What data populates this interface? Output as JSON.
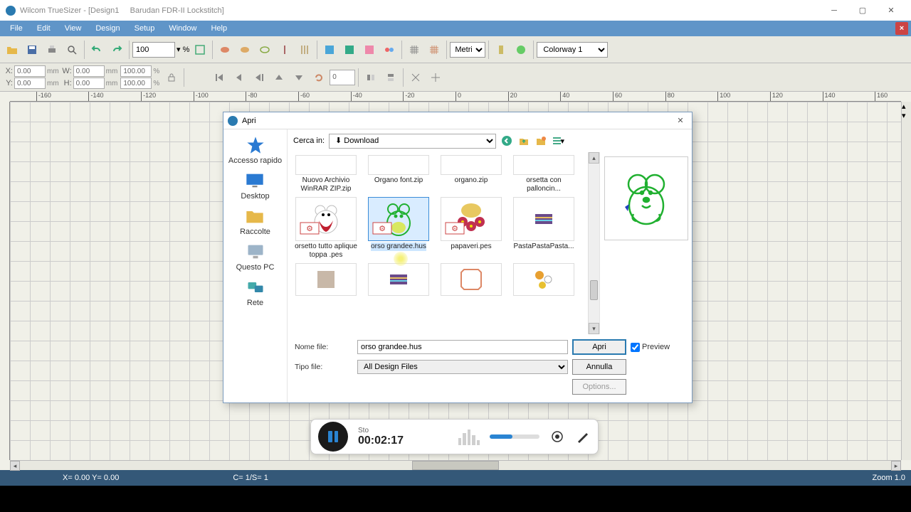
{
  "titlebar": {
    "app": "Wilcom TrueSizer - [Design1",
    "doc": "Barudan FDR-II Lockstitch]"
  },
  "menu": {
    "file": "File",
    "edit": "Edit",
    "view": "View",
    "design": "Design",
    "setup": "Setup",
    "window": "Window",
    "help": "Help"
  },
  "toolbar": {
    "zoom_value": "100",
    "zoom_pct": "%",
    "units": "Metric",
    "colorway": "Colorway 1"
  },
  "props": {
    "x_lbl": "X:",
    "x": "0.00",
    "y_lbl": "Y:",
    "y": "0.00",
    "mm": "mm",
    "w_lbl": "W:",
    "w": "0.00",
    "h_lbl": "H:",
    "h": "0.00",
    "wp": "100.00",
    "hp": "100.00",
    "pct": "%",
    "ang": "0"
  },
  "ruler_ticks": [
    "-160",
    "-140",
    "-120",
    "-100",
    "-80",
    "-60",
    "-40",
    "-20",
    "0",
    "20",
    "40",
    "60",
    "80",
    "100",
    "120",
    "140",
    "160"
  ],
  "dialog": {
    "title": "Apri",
    "lookin_label": "Cerca in:",
    "lookin_value": "Download",
    "places": {
      "quick": "Accesso rapido",
      "desktop": "Desktop",
      "collections": "Raccolte",
      "thispc": "Questo PC",
      "network": "Rete"
    },
    "files_row1": [
      {
        "name": "Nuovo Archivio WinRAR ZIP.zip"
      },
      {
        "name": "Organo font.zip"
      },
      {
        "name": "organo.zip"
      },
      {
        "name": "orsetta con palloncin..."
      }
    ],
    "files_row2": [
      {
        "name": "orsetto tutto aplique toppa .pes"
      },
      {
        "name": "orso grandee.hus",
        "selected": true
      },
      {
        "name": "papaveri.pes"
      },
      {
        "name": "PastaPastaPasta..."
      }
    ],
    "filename_label": "Nome file:",
    "filename_value": "orso grandee.hus",
    "filetype_label": "Tipo file:",
    "filetype_value": "All Design Files",
    "open_btn": "Apri",
    "cancel_btn": "Annulla",
    "options_btn": "Options...",
    "preview_label": "Preview"
  },
  "recorder": {
    "status": "Sto",
    "time": "00:02:17"
  },
  "status": {
    "xy": "X=   0.00 Y=   0.00",
    "cs": "C=  1/S=  1",
    "zoom": "Zoom 1.0"
  }
}
